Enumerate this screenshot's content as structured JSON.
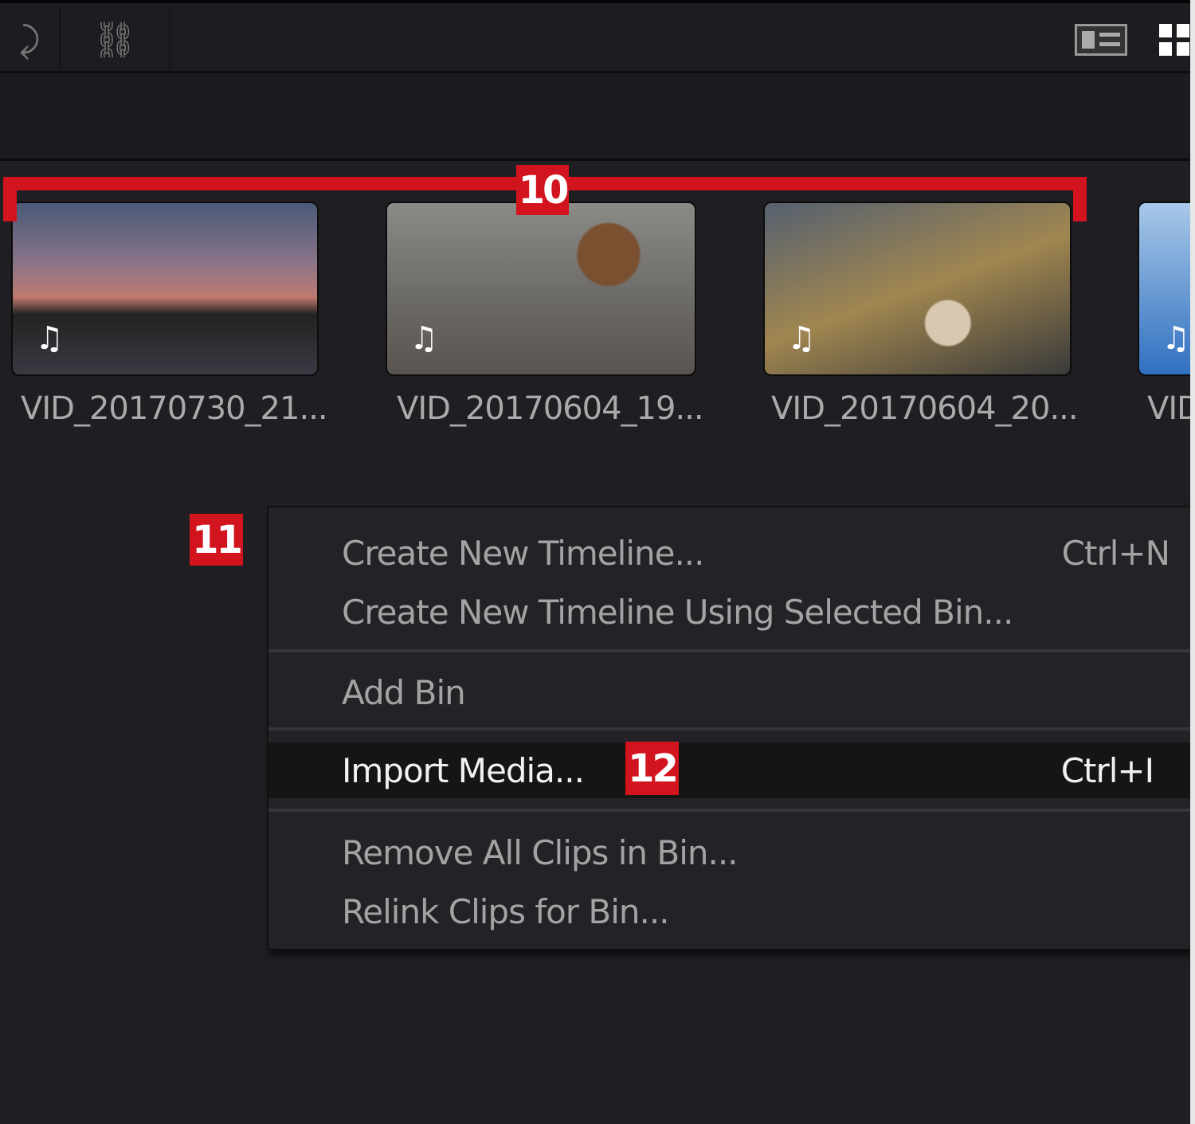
{
  "toolbar": {
    "icons": [
      "link-swap-icon",
      "unlink-icon",
      "list-view-icon",
      "grid-view-icon"
    ]
  },
  "clips": [
    {
      "name": "VID_20170730_21..."
    },
    {
      "name": "VID_20170604_19..."
    },
    {
      "name": "VID_20170604_20..."
    },
    {
      "name": "VID"
    }
  ],
  "annotations": {
    "a10": "10",
    "a11": "11",
    "a12": "12"
  },
  "menu": {
    "items": [
      {
        "label": "Create New Timeline...",
        "shortcut": "Ctrl+N"
      },
      {
        "label": "Create New Timeline Using Selected Bin..."
      },
      {
        "label": "Add Bin"
      },
      {
        "label": "Import Media...",
        "shortcut": "Ctrl+I"
      },
      {
        "label": "Remove All Clips in Bin..."
      },
      {
        "label": "Relink Clips for Bin..."
      }
    ]
  },
  "colors": {
    "accent": "#d2141e",
    "background": "#1f1f23"
  }
}
